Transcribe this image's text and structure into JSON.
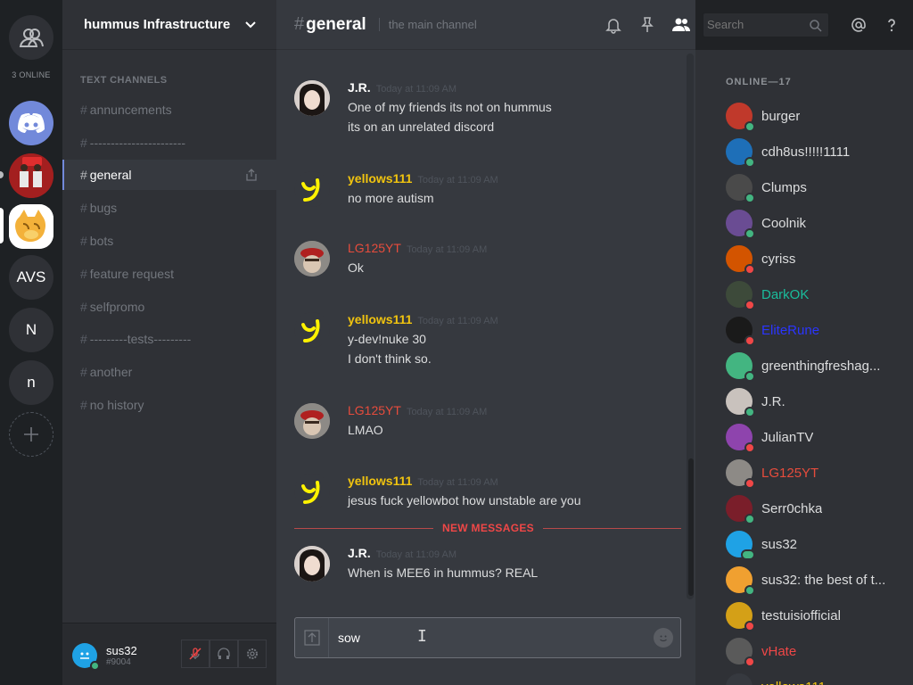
{
  "rail": {
    "online_count": "3 ONLINE",
    "servers": [
      {
        "kind": "discord",
        "label": ""
      },
      {
        "kind": "youtube",
        "label": ""
      },
      {
        "kind": "cat",
        "label": ""
      },
      {
        "kind": "text",
        "label": "AVS"
      },
      {
        "kind": "text",
        "label": "N"
      },
      {
        "kind": "text",
        "label": "n"
      }
    ]
  },
  "guild": {
    "name": "hummus Infrastructure"
  },
  "channels": {
    "category": "TEXT CHANNELS",
    "items": [
      {
        "name": "annuncements",
        "active": false
      },
      {
        "name": "-----------------------",
        "active": false
      },
      {
        "name": "general",
        "active": true
      },
      {
        "name": "bugs",
        "active": false
      },
      {
        "name": "bots",
        "active": false
      },
      {
        "name": "feature request",
        "active": false
      },
      {
        "name": "selfpromo",
        "active": false
      },
      {
        "name": "---------tests---------",
        "active": false
      },
      {
        "name": "another",
        "active": false
      },
      {
        "name": "no history",
        "active": false
      }
    ]
  },
  "user": {
    "name": "sus32",
    "tag": "#9004"
  },
  "chat": {
    "channel": "general",
    "topic": "the main channel",
    "new_messages_label": "NEW MESSAGES",
    "composer_value": "sow",
    "messages": [
      {
        "author": "J.R.",
        "color": "#ffffff",
        "time": "Today at 11:09 AM",
        "lines": [
          "One of my friends its not on hummus",
          "its on an unrelated discord"
        ]
      },
      {
        "author": "yellows111",
        "color": "#f1c40f",
        "time": "Today at 11:09 AM",
        "lines": [
          "no more autism"
        ]
      },
      {
        "author": "LG125YT",
        "color": "#e74c3c",
        "time": "Today at 11:09 AM",
        "lines": [
          "Ok"
        ]
      },
      {
        "author": "yellows111",
        "color": "#f1c40f",
        "time": "Today at 11:09 AM",
        "lines": [
          "y-dev!nuke 30",
          "I don't think so."
        ]
      },
      {
        "author": "LG125YT",
        "color": "#e74c3c",
        "time": "Today at 11:09 AM",
        "lines": [
          "LMAO"
        ]
      },
      {
        "author": "yellows111",
        "color": "#f1c40f",
        "time": "Today at 11:09 AM",
        "lines": [
          "jesus fuck yellowbot how unstable are you"
        ]
      },
      {
        "author": "J.R.",
        "color": "#ffffff",
        "time": "Today at 11:09 AM",
        "lines": [
          "When is MEE6 in hummus? REAL"
        ]
      }
    ]
  },
  "search": {
    "placeholder": "Search"
  },
  "members": {
    "label": "ONLINE—17",
    "list": [
      {
        "name": "burger",
        "color": "#dcddde",
        "status": "online"
      },
      {
        "name": "cdh8us!!!!!1111",
        "color": "#dcddde",
        "status": "online"
      },
      {
        "name": "Clumps",
        "color": "#dcddde",
        "status": "online"
      },
      {
        "name": "Coolnik",
        "color": "#dcddde",
        "status": "online"
      },
      {
        "name": "cyriss",
        "color": "#dcddde",
        "status": "dnd"
      },
      {
        "name": "DarkOK",
        "color": "#1abc9c",
        "status": "dnd"
      },
      {
        "name": "EliteRune",
        "color": "#2b35ff",
        "status": "dnd"
      },
      {
        "name": "greenthingfreshag...",
        "color": "#dcddde",
        "status": "online"
      },
      {
        "name": "J.R.",
        "color": "#dcddde",
        "status": "online"
      },
      {
        "name": "JulianTV",
        "color": "#dcddde",
        "status": "dnd"
      },
      {
        "name": "LG125YT",
        "color": "#e74c3c",
        "status": "dnd"
      },
      {
        "name": "Serr0chka",
        "color": "#dcddde",
        "status": "online"
      },
      {
        "name": "sus32",
        "color": "#dcddde",
        "status": "mobile"
      },
      {
        "name": "sus32: the best of t...",
        "color": "#dcddde",
        "status": "online"
      },
      {
        "name": "testuisiofficial",
        "color": "#dcddde",
        "status": "dnd"
      },
      {
        "name": "vHate",
        "color": "#f04747",
        "status": "dnd"
      },
      {
        "name": "yellows111",
        "color": "#f1c40f",
        "status": "online"
      }
    ]
  }
}
